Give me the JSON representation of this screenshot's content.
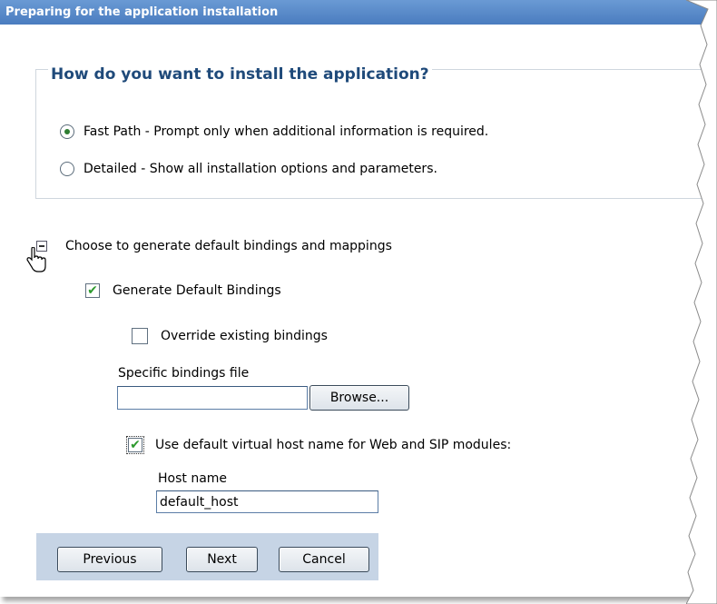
{
  "window": {
    "title": "Preparing for the application installation"
  },
  "install_group": {
    "legend": "How do you want to install the application?",
    "options": [
      {
        "label": "Fast Path - Prompt only when additional information is required.",
        "selected": true
      },
      {
        "label": "Detailed - Show all installation options and parameters.",
        "selected": false
      }
    ]
  },
  "bindings": {
    "section_label": "Choose to generate default bindings and mappings",
    "generate_default_bindings": {
      "label": "Generate Default Bindings",
      "checked": true
    },
    "override_existing_bindings": {
      "label": "Override existing bindings",
      "checked": false
    },
    "specific_bindings_file": {
      "label": "Specific bindings file",
      "value": "",
      "browse_label": "Browse..."
    },
    "use_default_virtual_host": {
      "label": "Use default virtual host name for Web and SIP modules:",
      "checked": true
    },
    "host_name": {
      "label": "Host name",
      "value": "default_host"
    }
  },
  "buttons": {
    "previous": "Previous",
    "next": "Next",
    "cancel": "Cancel"
  },
  "icons": {
    "toggle": "collapse-icon",
    "cursor": "hand-cursor-icon",
    "check": "✔"
  },
  "colors": {
    "title_bar": "#4a7cbf",
    "legend_text": "#1f4a7a",
    "button_bar": "#c6d4e5",
    "check": "#2e9a2e"
  }
}
